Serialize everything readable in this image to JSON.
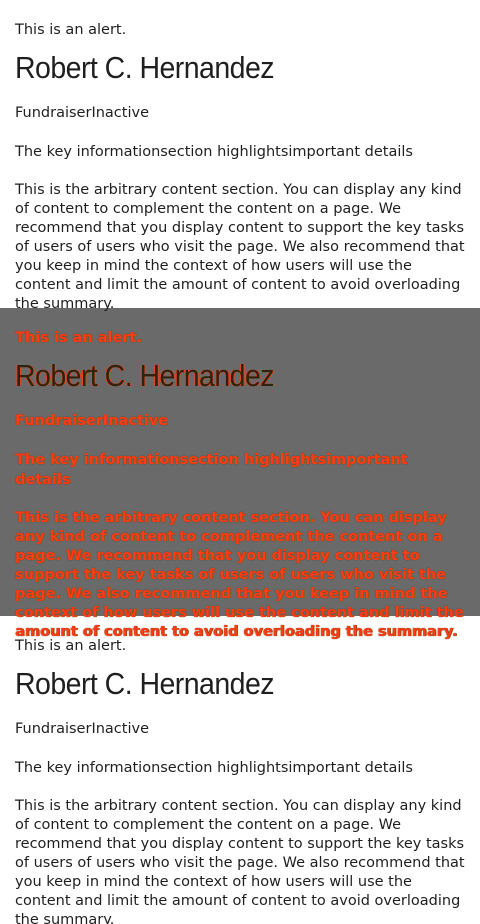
{
  "panels": [
    {
      "alert": "This is an alert.",
      "name": "Robert C. Hernandez",
      "subtitle": "FundraiserInactive",
      "key_info": "The key informationsection highlightsimportant details",
      "content": "This is the arbitrary content section. You can display any kind of content to complement the content on a page. We recommend that you display content to support the key tasks of users of users who visit the page. We also recommend that you keep in mind the context of how users will use the content and limit the amount of content to avoid overloading the summary."
    },
    {
      "alert": "This is an alert.",
      "name": "Robert C. Hernandez",
      "subtitle": "FundraiserInactive",
      "key_info": "The key informationsection highlightsimportant details",
      "content": "This is the arbitrary content section. You can display any kind of content to complement the content on a page. We recommend that you display content to support the key tasks of users of users who visit the page. We also recommend that you keep in mind the context of how users will use the content and limit the amount of content to avoid overloading the summary."
    },
    {
      "alert": "This is an alert.",
      "name": "Robert C. Hernandez",
      "subtitle": "FundraiserInactive",
      "key_info": "The key informationsection highlightsimportant details",
      "content": "This is the arbitrary content section. You can display any kind of content to complement the content on a page. We recommend that you display content to support the key tasks of users of users who visit the page. We also recommend that you keep in mind the context of how users will use the content and limit the amount of content to avoid overloading the summary."
    }
  ],
  "colors": {
    "text": "#1f1f1f",
    "dark_panel_bg": "#6a6a6a",
    "dark_panel_text": "#ff3b1a"
  }
}
